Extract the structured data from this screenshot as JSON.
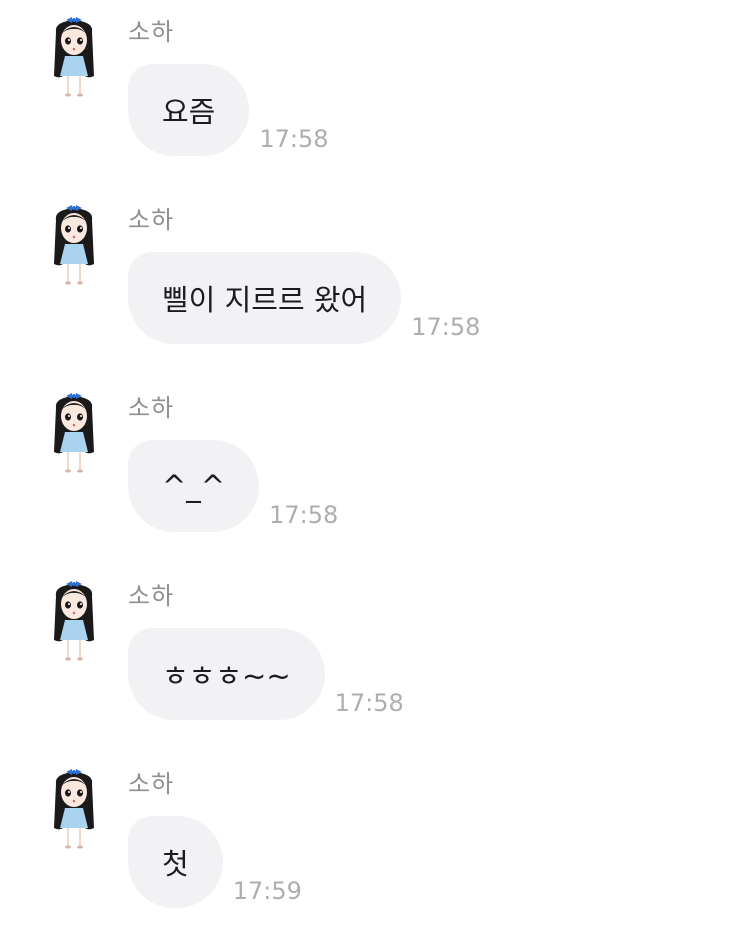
{
  "messages": [
    {
      "sender": "소하",
      "text": "요즘",
      "time": "17:58"
    },
    {
      "sender": "소하",
      "text": "삘이 지르르 왔어",
      "time": "17:58"
    },
    {
      "sender": "소하",
      "text": "^_^",
      "time": "17:58"
    },
    {
      "sender": "소하",
      "text": "ㅎㅎㅎ~~",
      "time": "17:58"
    },
    {
      "sender": "소하",
      "text": "첫",
      "time": "17:59"
    }
  ],
  "colors": {
    "bubble": "#f2f2f5",
    "sender_text": "#8e8e93",
    "time_text": "#aeaeb2",
    "message_text": "#1c1c1e",
    "avatar_hair": "#1a1a1a",
    "avatar_dress": "#a9d3ee",
    "avatar_bow": "#2f6fd6"
  },
  "icons": {
    "avatar": "girl-character-avatar"
  }
}
